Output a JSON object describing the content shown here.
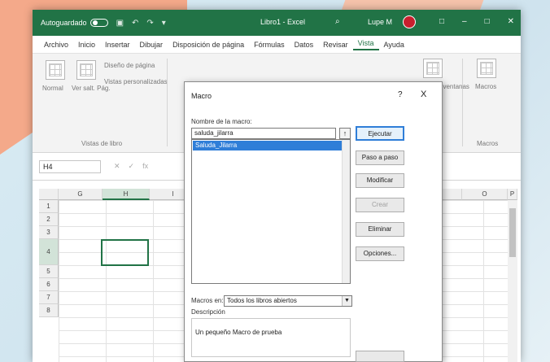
{
  "app": {
    "autosave_label": "Autoguardado",
    "doc_title": "Libro1 - Excel",
    "user_name": "Lupe M"
  },
  "ribbon": {
    "tabs": [
      "Archivo",
      "Inicio",
      "Insertar",
      "Dibujar",
      "Disposición de página",
      "Fórmulas",
      "Datos",
      "Revisar",
      "Vista",
      "Ayuda"
    ],
    "active_tab": "Vista",
    "group_views_label": "Vistas de libro",
    "normal_label": "Normal",
    "page_break_label": "Ver salt. Pág.",
    "page_layout_label": "Diseño de página",
    "custom_views_label": "Vistas personalizadas",
    "switch_windows_label": "Cambiar ventanas",
    "macros_btn_label": "Macros",
    "macros_group_label": "Macros"
  },
  "formula_bar": {
    "name_box": "H4"
  },
  "grid": {
    "columns": [
      "G",
      "H",
      "I",
      "N",
      "O",
      "P"
    ],
    "rows": [
      "1",
      "2",
      "3",
      "4",
      "5",
      "6",
      "7",
      "8"
    ]
  },
  "dialog": {
    "title": "Macro",
    "help": "?",
    "close": "X",
    "macro_name_label": "Nombre de la macro:",
    "macro_name_value": "saluda_jilarra",
    "macro_list": [
      "Saluda_Jilarra"
    ],
    "buttons": {
      "run": "Ejecutar",
      "step_into": "Paso a paso",
      "edit": "Modificar",
      "create": "Crear",
      "delete": "Eliminar",
      "options": "Opciones..."
    },
    "macros_in_label": "Macros en:",
    "macros_in_value": "Todos los libros abiertos",
    "description_label": "Descripción",
    "description_text": "Un pequeño Macro de prueba"
  }
}
